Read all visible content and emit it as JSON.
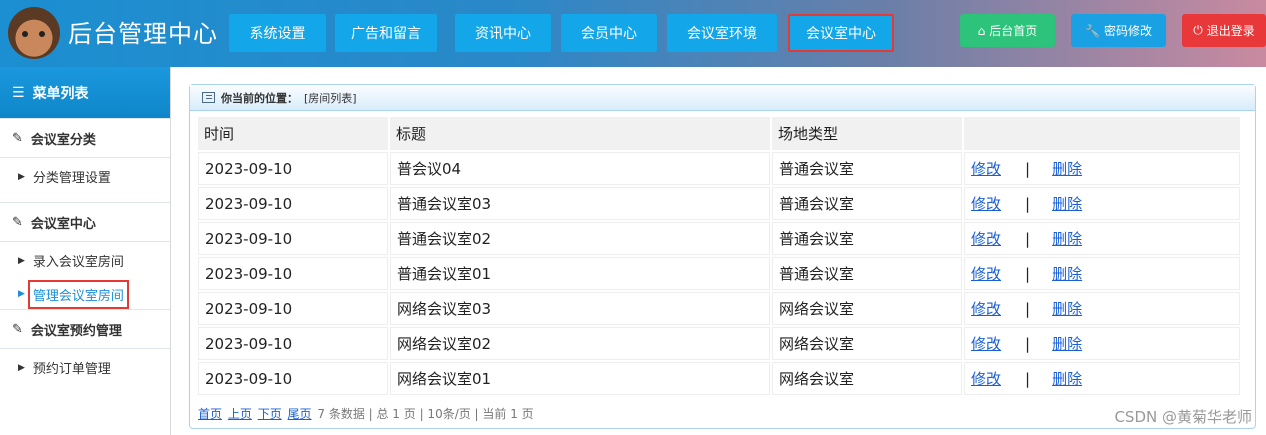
{
  "header": {
    "title": "后台管理中心",
    "nav": [
      {
        "label": "系统设置",
        "active": false
      },
      {
        "label": "广告和留言",
        "active": false
      },
      {
        "label": "资讯中心",
        "active": false
      },
      {
        "label": "会员中心",
        "active": false
      },
      {
        "label": "会议室环境",
        "active": false
      },
      {
        "label": "会议室中心",
        "active": true
      }
    ],
    "actions": {
      "home": "后台首页",
      "password": "密码修改",
      "logout": "退出登录"
    }
  },
  "sidebar": {
    "title": "菜单列表",
    "groups": [
      {
        "label": "会议室分类",
        "items": [
          "分类管理设置"
        ]
      },
      {
        "label": "会议室中心",
        "items": [
          "录入会议室房间",
          "管理会议室房间"
        ]
      },
      {
        "label": "会议室预约管理",
        "items": [
          "预约订单管理"
        ]
      }
    ],
    "active_item": "管理会议室房间"
  },
  "breadcrumb": {
    "prefix": "你当前的位置：",
    "current": "[房间列表]"
  },
  "table": {
    "columns": [
      "时间",
      "标题",
      "场地类型",
      ""
    ],
    "rows": [
      {
        "date": "2023-09-10",
        "title": "普会议04",
        "type": "普通会议室"
      },
      {
        "date": "2023-09-10",
        "title": "普通会议室03",
        "type": "普通会议室"
      },
      {
        "date": "2023-09-10",
        "title": "普通会议室02",
        "type": "普通会议室"
      },
      {
        "date": "2023-09-10",
        "title": "普通会议室01",
        "type": "普通会议室"
      },
      {
        "date": "2023-09-10",
        "title": "网络会议室03",
        "type": "网络会议室"
      },
      {
        "date": "2023-09-10",
        "title": "网络会议室02",
        "type": "网络会议室"
      },
      {
        "date": "2023-09-10",
        "title": "网络会议室01",
        "type": "网络会议室"
      }
    ],
    "edit_label": "修改",
    "delete_label": "删除",
    "separator": "|"
  },
  "pager": {
    "first": "首页",
    "prev": "上页",
    "next": "下页",
    "last": "尾页",
    "summary": "7 条数据 | 总 1 页 | 10条/页 | 当前 1 页"
  },
  "watermark": "CSDN @黄菊华老师"
}
